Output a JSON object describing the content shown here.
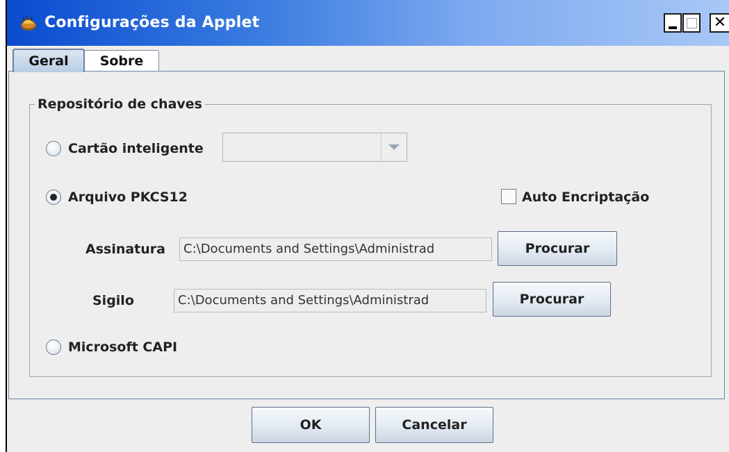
{
  "window": {
    "title": "Configurações da Applet",
    "title_icon": "java-coffee-icon",
    "controls": [
      "minimize-icon",
      "maximize-icon",
      "close-icon"
    ]
  },
  "tabs": [
    {
      "label": "Geral",
      "selected": true
    },
    {
      "label": "Sobre",
      "selected": false
    }
  ],
  "keystore": {
    "legend": "Repositório de chaves",
    "smartcard": {
      "label": "Cartão inteligente",
      "selected": false,
      "combo_value": ""
    },
    "pkcs12": {
      "label": "Arquivo PKCS12",
      "selected": true,
      "auto_encrypt_label": "Auto Encriptação",
      "auto_encrypt_checked": false,
      "assinatura": {
        "label": "Assinatura",
        "value": "C:\\Documents and Settings\\Administrad",
        "button": "Procurar"
      },
      "sigilo": {
        "label": "Sigilo",
        "value": "C:\\Documents and Settings\\Administrad",
        "button": "Procurar"
      }
    },
    "capi": {
      "label": "Microsoft CAPI",
      "selected": false
    }
  },
  "footer": {
    "ok_label": "OK",
    "cancel_label": "Cancelar"
  },
  "colors": {
    "titlebar_start": "#0a4bd0",
    "titlebar_end": "#a8c8f6",
    "background": "#eeeeee"
  }
}
